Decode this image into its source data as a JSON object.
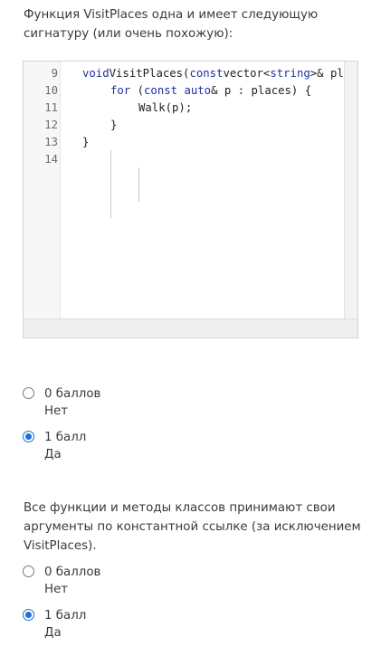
{
  "question1": {
    "prompt": "Функция VisitPlaces одна и имеет следующую сигнатуру (или очень похожую):",
    "code": {
      "lines": [
        {
          "no": "9",
          "indent": 0,
          "tokens": [
            [
              "kw",
              "void"
            ],
            [
              "",
              "VisitPlaces("
            ],
            [
              "kw",
              "const"
            ],
            [
              "",
              "vector<"
            ],
            [
              "ty",
              "string"
            ],
            [
              "",
              ">& places"
            ]
          ]
        },
        {
          "no": "10",
          "indent": 1,
          "tokens": [
            [
              "kw",
              "for"
            ],
            [
              "",
              " ("
            ],
            [
              "kw",
              "const"
            ],
            [
              "",
              " "
            ],
            [
              "kw",
              "auto"
            ],
            [
              "",
              "& p : places) {"
            ]
          ]
        },
        {
          "no": "11",
          "indent": 2,
          "tokens": [
            [
              "",
              "Walk(p);"
            ]
          ]
        },
        {
          "no": "12",
          "indent": 1,
          "tokens": [
            [
              "",
              "}"
            ]
          ]
        },
        {
          "no": "13",
          "indent": 0,
          "tokens": [
            [
              "",
              "}"
            ]
          ]
        },
        {
          "no": "14",
          "indent": 0,
          "tokens": []
        }
      ]
    },
    "options": [
      {
        "score": "0 баллов",
        "text": "Нет",
        "checked": false
      },
      {
        "score": "1 балл",
        "text": "Да",
        "checked": true
      }
    ]
  },
  "question2": {
    "prompt": "Все функции и методы классов принимают свои аргументы по константной ссылке (за исключением VisitPlaces).",
    "options": [
      {
        "score": "0 баллов",
        "text": "Нет",
        "checked": false
      },
      {
        "score": "1 балл",
        "text": "Да",
        "checked": true
      }
    ]
  }
}
